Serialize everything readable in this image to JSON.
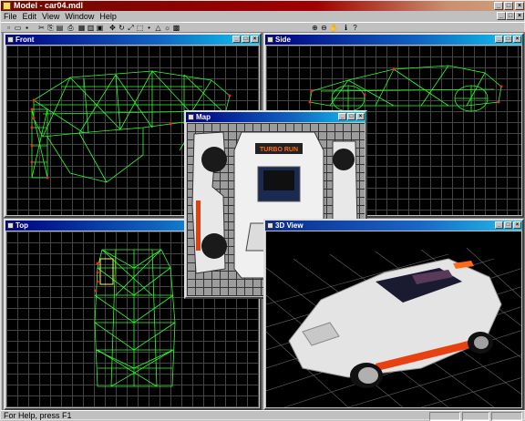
{
  "app": {
    "title": "Model - car04.mdl"
  },
  "menu": {
    "items": [
      "File",
      "Edit",
      "View",
      "Window",
      "Help"
    ]
  },
  "toolbar": {
    "icons": [
      "new-icon",
      "open-icon",
      "save-icon",
      "cut-icon",
      "copy-icon",
      "paste-icon",
      "print-icon",
      "view-grid-icon",
      "view-multi-icon",
      "view-single-icon",
      "move-icon",
      "rotate-icon",
      "scale-icon",
      "select-icon",
      "vertex-icon",
      "face-icon",
      "light-icon",
      "texture-icon",
      "zoom-in-icon",
      "zoom-out-icon",
      "pan-icon",
      "about-icon",
      "help-icon"
    ]
  },
  "windows": {
    "front": {
      "title": "Front"
    },
    "side": {
      "title": "Side"
    },
    "top": {
      "title": "Top"
    },
    "map": {
      "title": "Map",
      "plate_text": "TURBO RUN"
    },
    "view3d": {
      "title": "3D View"
    }
  },
  "status": {
    "text": "For Help, press F1"
  },
  "colors": {
    "wireframe": "#2cff2c",
    "vertex": "#ff2020",
    "caption_active": "#0a2a8c",
    "accent": "#ff6a1a"
  }
}
